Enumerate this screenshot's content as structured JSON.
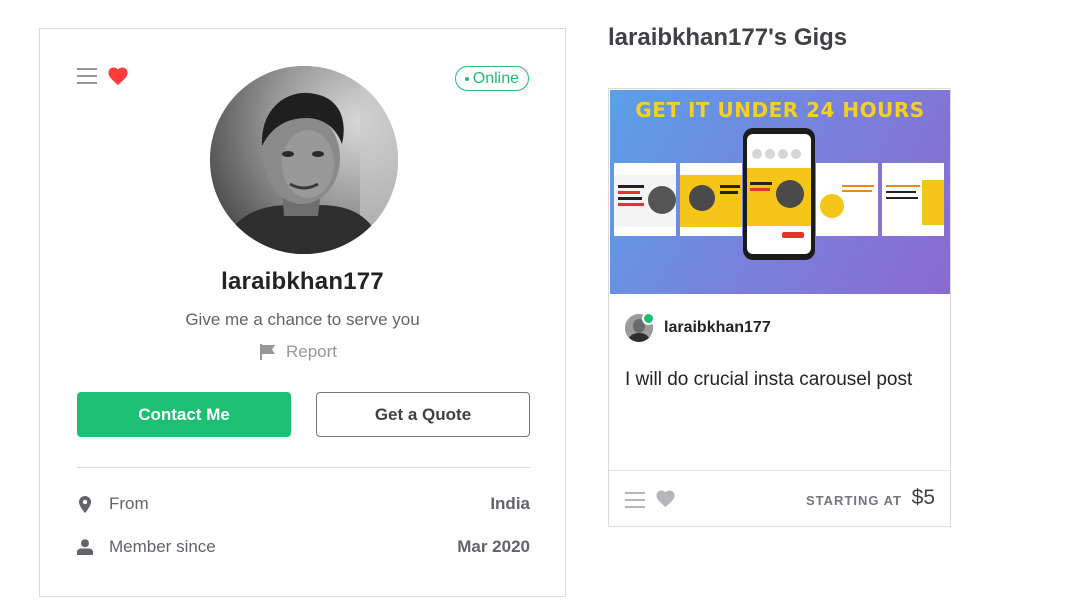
{
  "profile": {
    "status": "Online",
    "username": "laraibkhan177",
    "tagline": "Give me a chance to serve you",
    "report_label": "Report",
    "contact_label": "Contact Me",
    "quote_label": "Get a Quote",
    "stats": [
      {
        "label": "From",
        "value": "India",
        "icon": "location-pin-icon"
      },
      {
        "label": "Member since",
        "value": "Mar 2020",
        "icon": "user-icon"
      }
    ]
  },
  "gigs": {
    "title": "laraibkhan177's Gigs",
    "items": [
      {
        "thumbnail_headline": "GET IT UNDER 24 HOURS",
        "seller": "laraibkhan177",
        "title": "I will do crucial insta carousel post",
        "starting_at_label": "STARTING AT",
        "price": "$5"
      }
    ]
  },
  "colors": {
    "accent": "#1dbf73",
    "heart_active": "#ff3b3b",
    "heart_inactive": "#b5b6ba"
  },
  "icons": [
    "list-icon",
    "heart-icon",
    "flag-icon",
    "location-pin-icon",
    "user-icon"
  ]
}
